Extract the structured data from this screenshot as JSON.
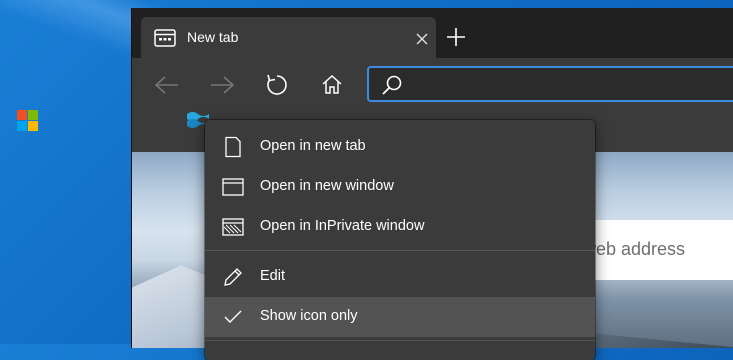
{
  "browser": {
    "tab": {
      "title": "New tab",
      "close_icon": "close-icon",
      "icon": "new-tab-page-icon"
    },
    "new_tab_icon": "plus-icon",
    "toolbar": {
      "back_icon": "back-arrow-icon",
      "forward_icon": "forward-arrow-icon",
      "refresh_icon": "refresh-icon",
      "home_icon": "home-icon",
      "address": {
        "value": "",
        "icon": "search-icon"
      }
    },
    "favorites": [
      {
        "name": "microsoft-favicon"
      },
      {
        "name": "flag-favicon"
      }
    ]
  },
  "page": {
    "search_placeholder": "r web address"
  },
  "context_menu": {
    "items": [
      {
        "label": "Open in new tab",
        "icon": "page-icon"
      },
      {
        "label": "Open in new window",
        "icon": "window-icon"
      },
      {
        "label": "Open in InPrivate window",
        "icon": "inprivate-window-icon"
      },
      {
        "label": "Edit",
        "icon": "pencil-icon"
      },
      {
        "label": "Show icon only",
        "icon": "checkmark-icon",
        "checked": true
      }
    ]
  },
  "colors": {
    "accent": "#3b8be0",
    "chrome": "#3b3b3b",
    "titlebar": "#202020",
    "menu_bg": "#3b3b3b",
    "menu_hover": "#535353"
  }
}
